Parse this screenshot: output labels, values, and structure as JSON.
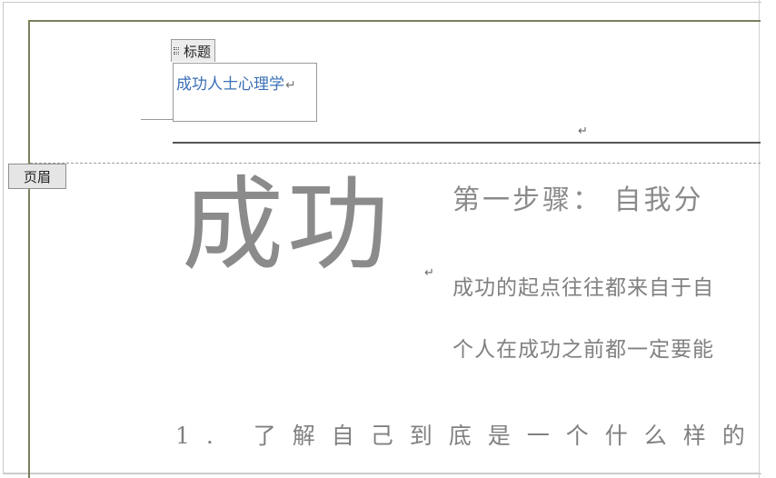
{
  "header_area": {
    "title_control_label": "标题",
    "title_value": "成功人士心理学",
    "paragraph_mark": "↵",
    "header_label": "页眉"
  },
  "content": {
    "big_title": "成功",
    "step_heading": "第一步骤： 自我分",
    "body_lines": [
      "成功的起点往往都来自于自",
      "个人在成功之前都一定要能"
    ],
    "list_item": "1. 了解自己到底是一个什么样的"
  }
}
